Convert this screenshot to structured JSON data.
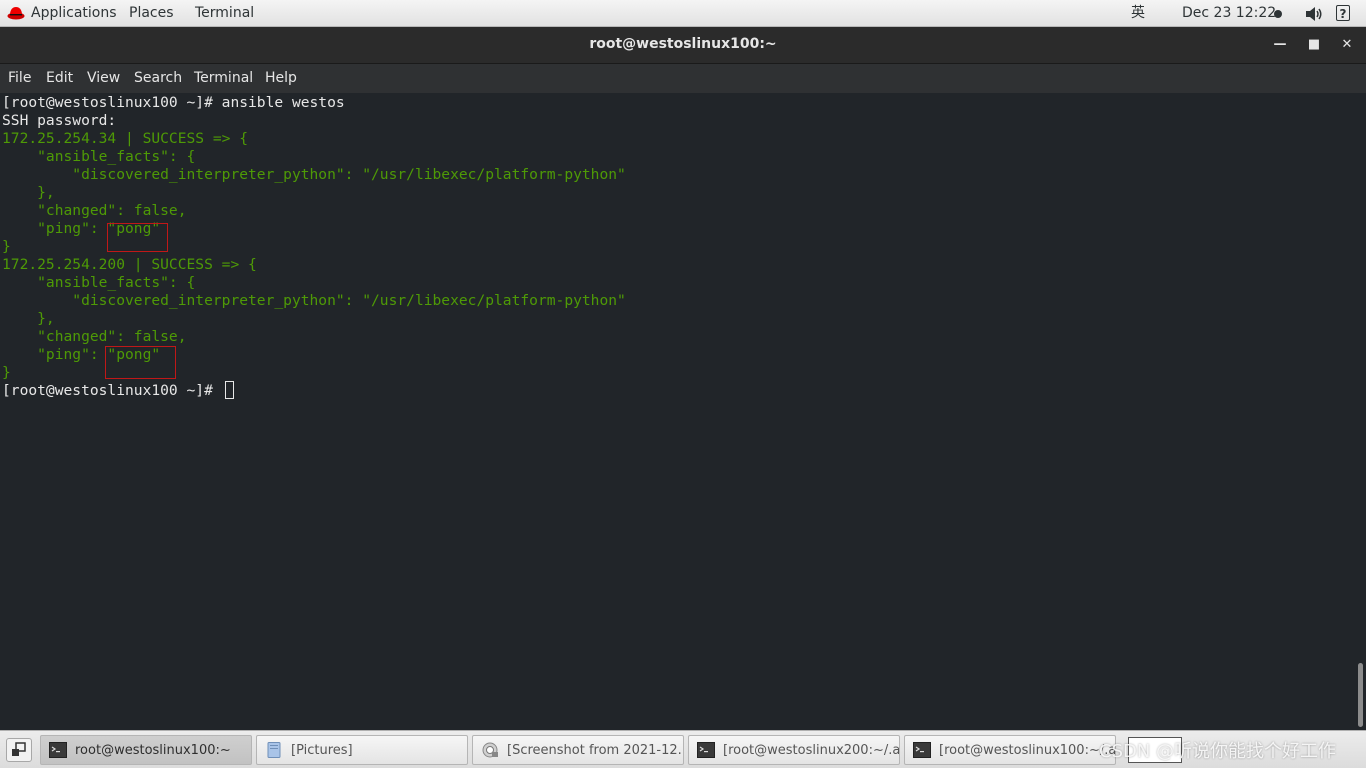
{
  "top_panel": {
    "applications_label": "Applications",
    "places_label": "Places",
    "terminal_label": "Terminal",
    "ime_label": "英",
    "clock": "Dec 23  12:22",
    "help_label": "?",
    "logo_icon": "redhat-logo",
    "volume_icon": "volume-icon"
  },
  "window": {
    "title": "root@westoslinux100:~",
    "minimize_label": "—",
    "maximize_label": "■",
    "close_label": "✕"
  },
  "menubar": {
    "file": "File",
    "edit": "Edit",
    "view": "View",
    "search": "Search",
    "terminal": "Terminal",
    "help": "Help"
  },
  "terminal": {
    "lines": [
      {
        "text": "[root@westoslinux100 ~]# ansible westos",
        "color": "#e7e7e7"
      },
      {
        "text": "SSH password:",
        "color": "#e7e7e7"
      },
      {
        "text": "172.25.254.34 | SUCCESS => {",
        "color": "#4e9a06"
      },
      {
        "text": "    \"ansible_facts\": {",
        "color": "#4e9a06"
      },
      {
        "text": "        \"discovered_interpreter_python\": \"/usr/libexec/platform-python\"",
        "color": "#4e9a06"
      },
      {
        "text": "    },",
        "color": "#4e9a06"
      },
      {
        "text": "    \"changed\": false,",
        "color": "#4e9a06"
      },
      {
        "text": "    \"ping\": \"pong\"",
        "color": "#4e9a06"
      },
      {
        "text": "}",
        "color": "#4e9a06"
      },
      {
        "text": "172.25.254.200 | SUCCESS => {",
        "color": "#4e9a06"
      },
      {
        "text": "    \"ansible_facts\": {",
        "color": "#4e9a06"
      },
      {
        "text": "        \"discovered_interpreter_python\": \"/usr/libexec/platform-python\"",
        "color": "#4e9a06"
      },
      {
        "text": "    },",
        "color": "#4e9a06"
      },
      {
        "text": "    \"changed\": false,",
        "color": "#4e9a06"
      },
      {
        "text": "    \"ping\": \"pong\"",
        "color": "#4e9a06"
      },
      {
        "text": "}",
        "color": "#4e9a06"
      },
      {
        "text": "[root@westoslinux100 ~]# ",
        "color": "#e7e7e7"
      }
    ]
  },
  "taskbar": {
    "tasks": [
      {
        "label": "root@westoslinux100:~",
        "icon": "terminal-icon",
        "active": true
      },
      {
        "label": "[Pictures]",
        "icon": "file-manager-icon",
        "active": false
      },
      {
        "label": "[Screenshot from 2021-12...",
        "icon": "image-viewer-icon",
        "active": false
      },
      {
        "label": "[root@westoslinux200:~/.a...",
        "icon": "terminal-icon",
        "active": false
      },
      {
        "label": "[root@westoslinux100:~/.a...",
        "icon": "terminal-icon",
        "active": false
      }
    ],
    "watermark": "CSDN @听说你能找个好工作"
  },
  "colors": {
    "terminal_bg": "#212529",
    "prompt_text": "#e7e7e7",
    "output_green": "#4e9a06",
    "highlight_red": "#c01818"
  }
}
